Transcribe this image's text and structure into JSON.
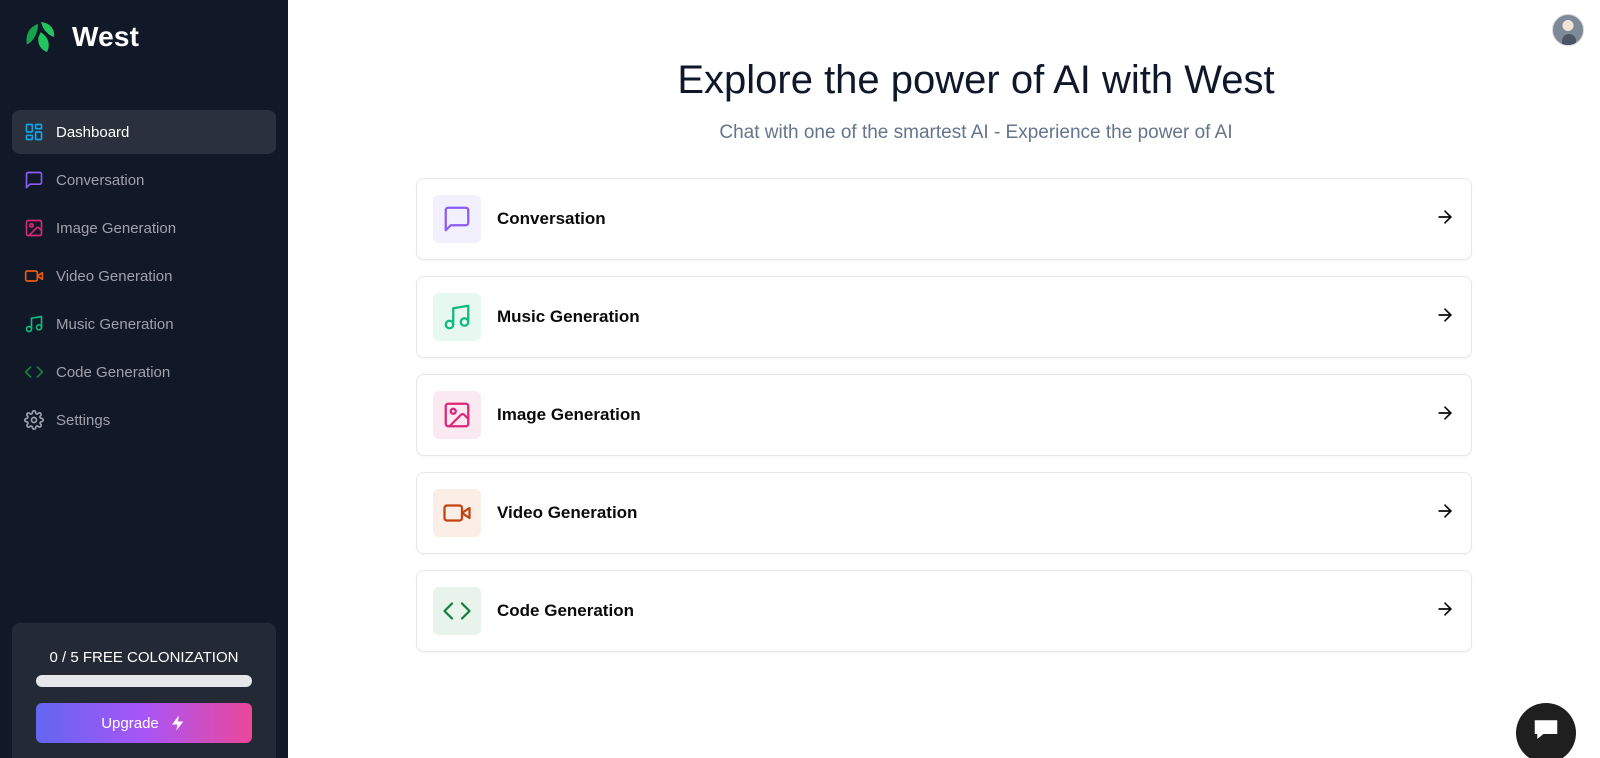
{
  "brand": {
    "name": "West",
    "logo_icon": "leaf-logo-icon",
    "color": "#22c55e"
  },
  "sidebar": {
    "items": [
      {
        "label": "Dashboard",
        "icon": "layout-grid-icon",
        "color": "#0ea5e9",
        "active": true
      },
      {
        "label": "Conversation",
        "icon": "message-square-icon",
        "color": "#8b5cf6",
        "active": false
      },
      {
        "label": "Image Generation",
        "icon": "image-icon",
        "color": "#db2777",
        "active": false
      },
      {
        "label": "Video Generation",
        "icon": "video-icon",
        "color": "#ea580c",
        "active": false
      },
      {
        "label": "Music Generation",
        "icon": "music-icon",
        "color": "#10b981",
        "active": false
      },
      {
        "label": "Code Generation",
        "icon": "code-icon",
        "color": "#15803d",
        "active": false
      },
      {
        "label": "Settings",
        "icon": "gear-icon",
        "color": "#9ca3af",
        "active": false
      }
    ],
    "free_counter": {
      "text": "0 / 5 FREE COLONIZATION",
      "used": 0,
      "limit": 5
    },
    "upgrade_label": "Upgrade"
  },
  "main": {
    "title": "Explore the power of AI with West",
    "subtitle": "Chat with one of the smartest AI - Experience the power of AI",
    "tools": [
      {
        "label": "Conversation",
        "icon": "message-square-icon",
        "color": "#8b5cf6",
        "bg": "#f3f0fe"
      },
      {
        "label": "Music Generation",
        "icon": "music-icon",
        "color": "#10b981",
        "bg": "#e7f8f1"
      },
      {
        "label": "Image Generation",
        "icon": "image-icon",
        "color": "#db2777",
        "bg": "#fbe9f1"
      },
      {
        "label": "Video Generation",
        "icon": "video-icon",
        "color": "#c2410c",
        "bg": "#fbeee6"
      },
      {
        "label": "Code Generation",
        "icon": "code-icon",
        "color": "#15803d",
        "bg": "#e8f3ec"
      }
    ]
  },
  "header": {
    "avatar": "user-avatar"
  },
  "support": {
    "icon": "chat-bubble-icon"
  }
}
